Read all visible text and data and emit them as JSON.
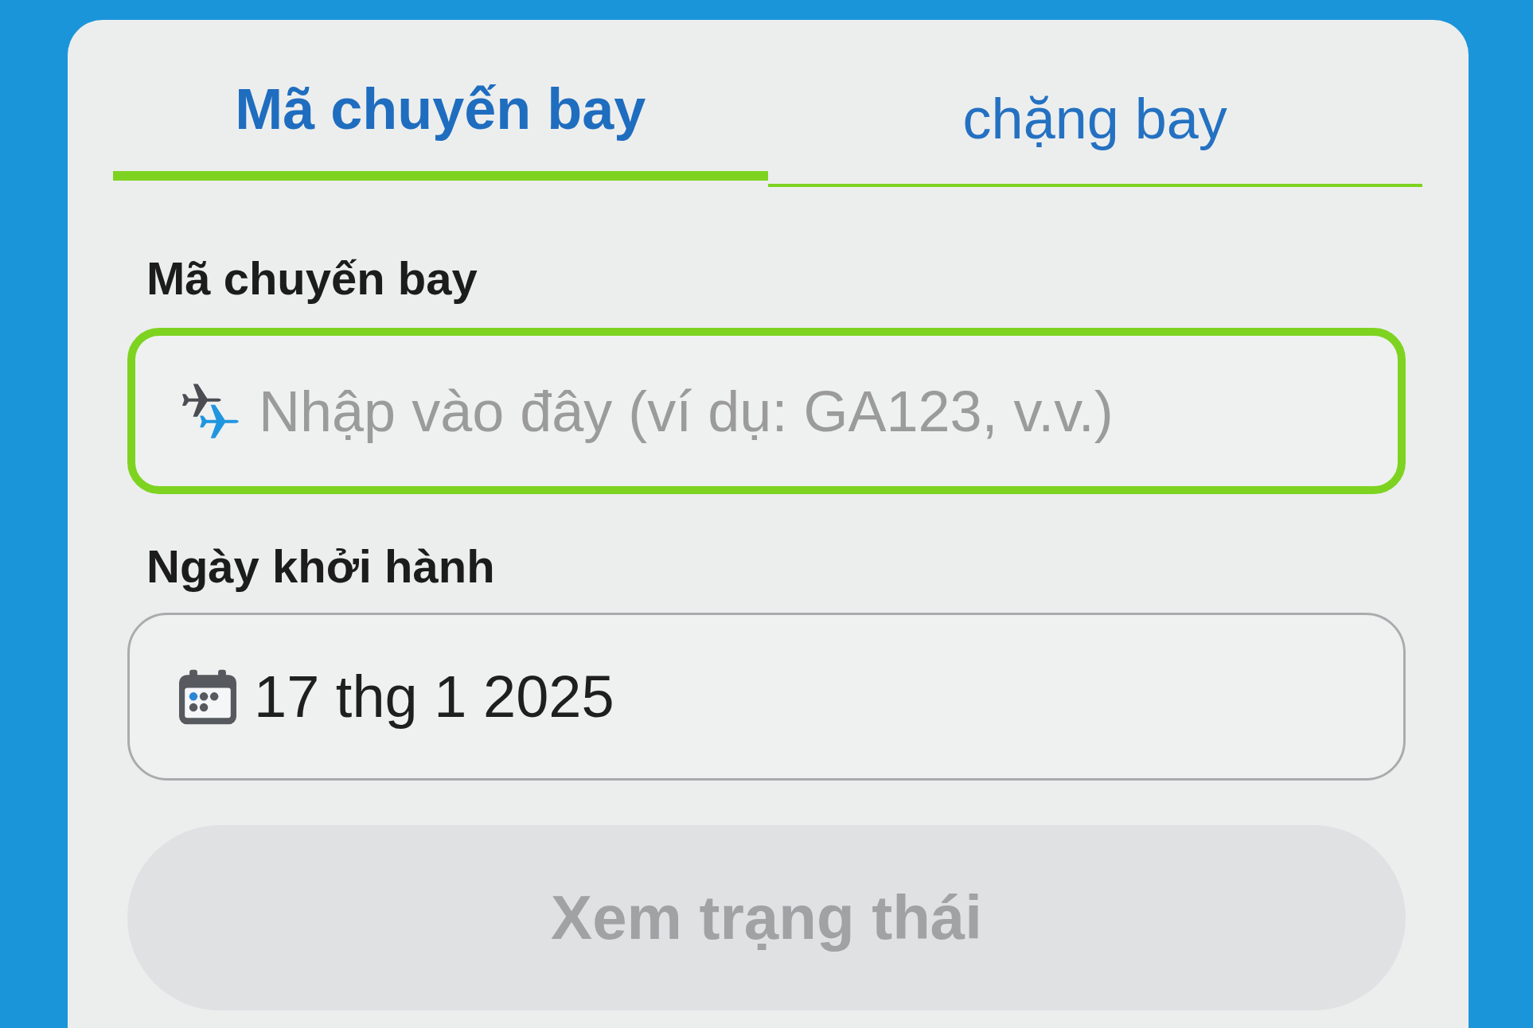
{
  "tabs": [
    {
      "label": "Mã chuyến bay",
      "selected": true
    },
    {
      "label": "chặng bay",
      "selected": false
    }
  ],
  "flight_code": {
    "label": "Mã chuyến bay",
    "placeholder": "Nhập vào đây (ví dụ: GA123, v.v.)",
    "focused": true
  },
  "departure_date": {
    "label": "Ngày khởi hành",
    "value": "17 thg 1 2025"
  },
  "submit_button": {
    "label": "Xem trạng thái",
    "disabled": true
  }
}
